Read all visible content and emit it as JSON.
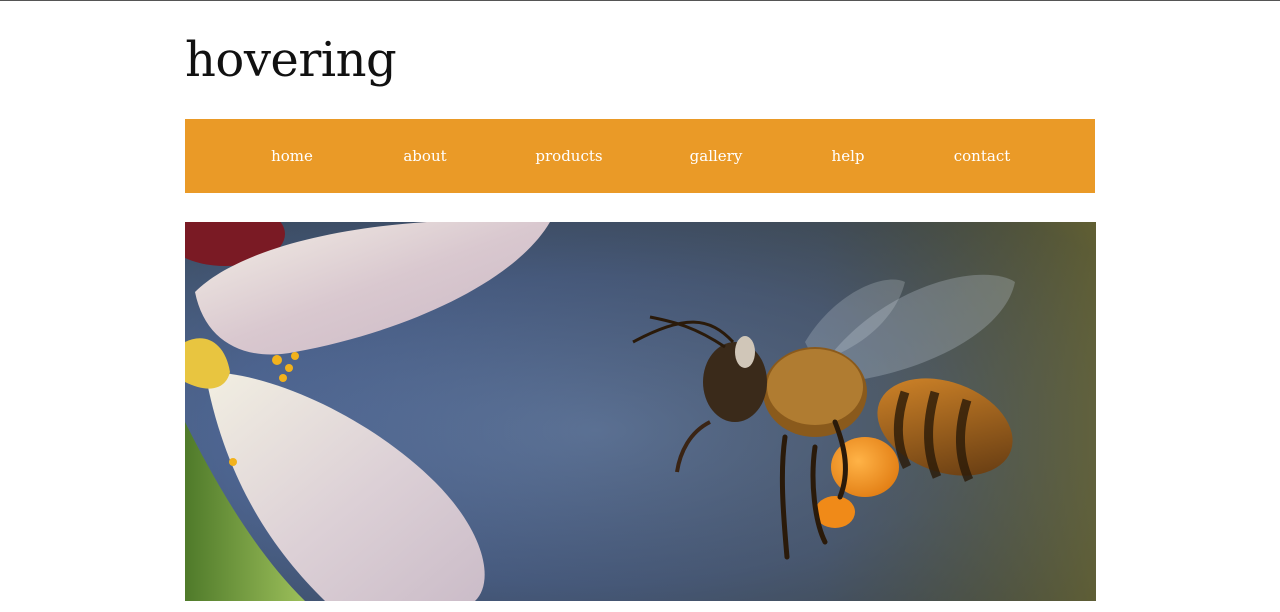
{
  "site": {
    "title": "hovering"
  },
  "nav": {
    "items": [
      {
        "label": "home"
      },
      {
        "label": "about"
      },
      {
        "label": "products"
      },
      {
        "label": "gallery"
      },
      {
        "label": "help"
      },
      {
        "label": "contact"
      }
    ]
  },
  "colors": {
    "nav_background": "#ea9a27",
    "nav_text": "#ffffff",
    "title_text": "#111111"
  },
  "hero": {
    "subject": "bee-photo"
  }
}
